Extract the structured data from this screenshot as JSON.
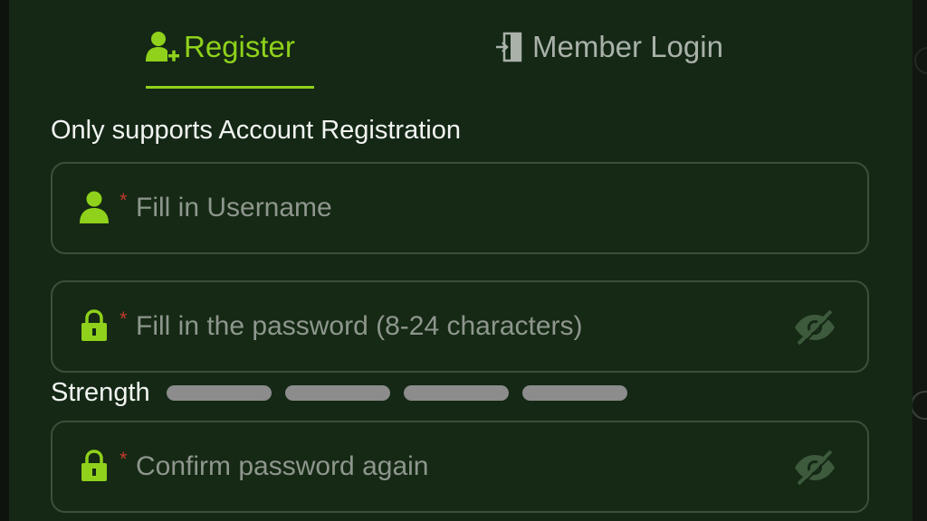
{
  "tabs": {
    "register": {
      "label": "Register",
      "icon": "user-plus-icon",
      "active": true
    },
    "login": {
      "label": "Member Login",
      "icon": "login-door-icon",
      "active": false
    }
  },
  "subtitle": "Only supports Account Registration",
  "form": {
    "username": {
      "placeholder": "Fill in Username",
      "value": "",
      "required_mark": "*",
      "icon": "user-icon"
    },
    "password": {
      "placeholder": "Fill in the password (8-24 characters)",
      "value": "",
      "required_mark": "*",
      "icon": "lock-icon",
      "toggle_icon": "eye-off-icon"
    },
    "strength": {
      "label": "Strength",
      "segments": 4,
      "level": 0
    },
    "confirm": {
      "placeholder": "Confirm password again",
      "value": "",
      "required_mark": "*",
      "icon": "lock-icon",
      "toggle_icon": "eye-off-icon"
    }
  },
  "colors": {
    "accent": "#8fd11b",
    "panel_bg": "#142815",
    "field_border": "#3d4f3c",
    "inactive_tab": "#a9b1a9",
    "required": "#c0392b",
    "strength_empty": "#8c8c8c"
  }
}
